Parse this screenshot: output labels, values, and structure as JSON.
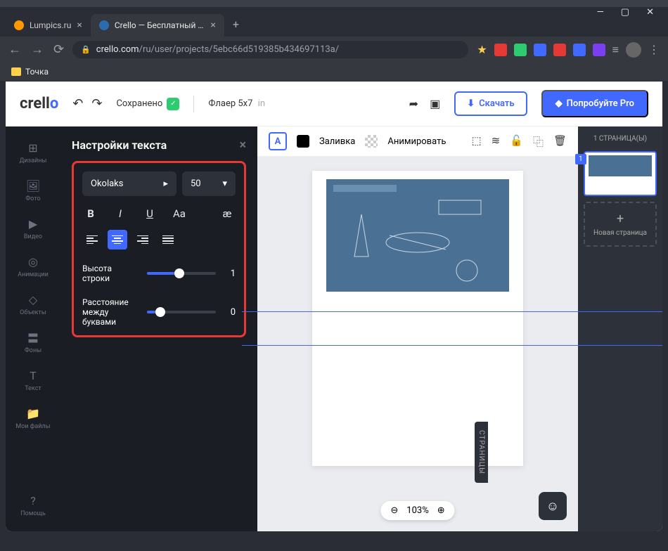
{
  "browser": {
    "tabs": [
      {
        "title": "Lumpics.ru"
      },
      {
        "title": "Crello — Бесплатный инструмен"
      }
    ],
    "url_prefix": "crello.com",
    "url_path": "/ru/user/projects/5ebc66d519385b434697113a/",
    "bookmark": "Точка"
  },
  "header": {
    "logo_main": "crell",
    "logo_accent": "o",
    "saved": "Сохранено",
    "design_name": "Флаер 5х7",
    "unit": "in",
    "download": "Скачать",
    "pro": "Попробуйте Pro"
  },
  "rail": {
    "designs": "Дизайны",
    "photo": "Фото",
    "video": "Видео",
    "animations": "Анимации",
    "objects": "Объекты",
    "backgrounds": "Фоны",
    "text": "Текст",
    "files": "Мои файлы",
    "help": "Помощь"
  },
  "panel": {
    "title": "Настройки текста",
    "font": "Okolaks",
    "size": "50",
    "bold": "B",
    "italic": "I",
    "underline": "U",
    "case": "Aa",
    "ligature": "æ",
    "line_height_label": "Высота строки",
    "line_height_val": "1",
    "letter_spacing_label": "Расстояние между буквами",
    "letter_spacing_val": "0"
  },
  "toolbar": {
    "text_btn": "A",
    "fill": "Заливка",
    "animate": "Анимировать"
  },
  "pages": {
    "count_label": "1 СТРАНИЦА(Ы)",
    "page1": "1",
    "new_page": "Новая страница",
    "tab": "СТРАНИЦЫ"
  },
  "zoom": {
    "level": "103%"
  }
}
